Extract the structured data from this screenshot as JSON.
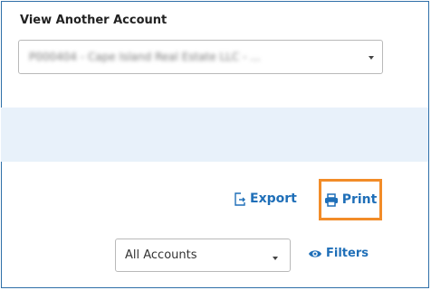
{
  "panel": {
    "title": "View Another Account",
    "account_select": {
      "value": "P000404 - Cape Island Real Estate LLC - ...",
      "obscured": true
    }
  },
  "actions": {
    "export_label": "Export",
    "print_label": "Print",
    "print_highlight_color": "#f28c28"
  },
  "filters": {
    "accounts_select_value": "All Accounts",
    "filters_label": "Filters"
  },
  "colors": {
    "accent": "#1f6fb8",
    "band": "#e8f1fa",
    "frame_border": "#2e6fa8"
  },
  "icons": {
    "export": "export-icon",
    "print": "printer-icon",
    "filters": "eye-icon",
    "dropdown": "chevron-down-icon"
  }
}
